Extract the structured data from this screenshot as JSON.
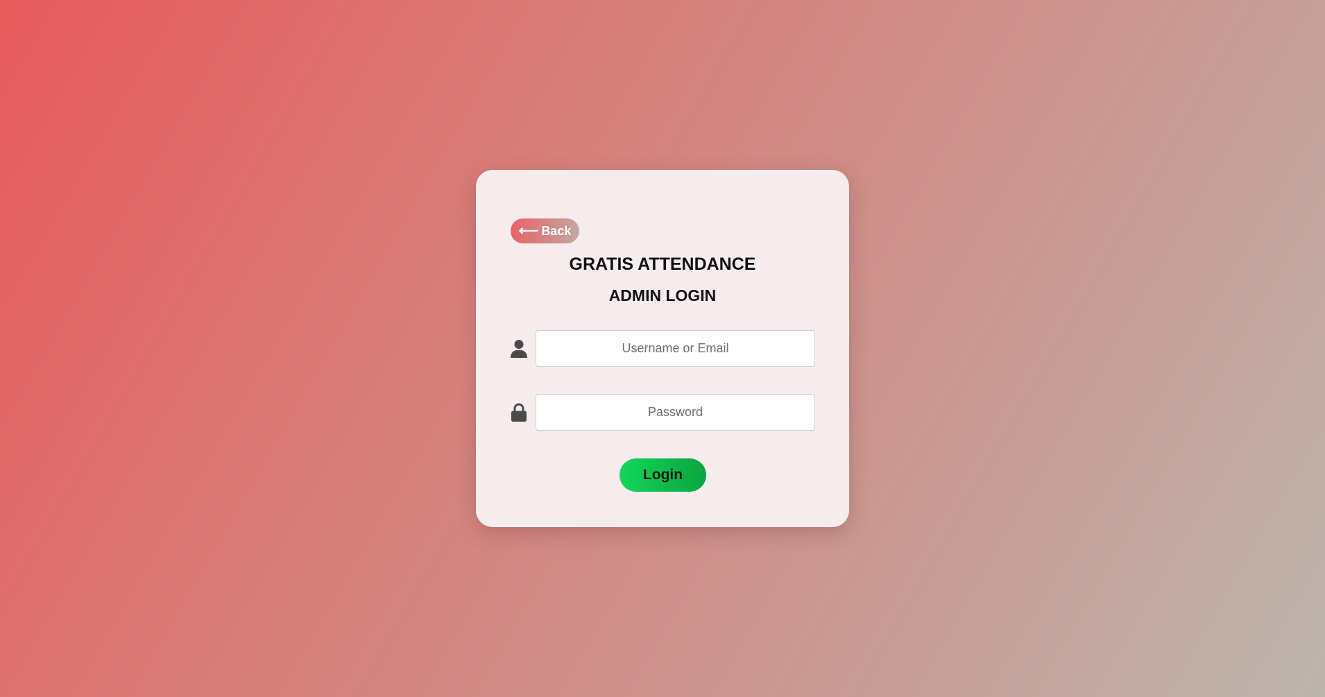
{
  "login_card": {
    "back_button": {
      "arrow_icon": "left-arrow-icon",
      "arrow_glyph": "⟵",
      "label": "Back"
    },
    "title": "GRATIS ATTENDANCE",
    "subtitle": "ADMIN LOGIN",
    "username_field": {
      "icon": "user-icon",
      "placeholder": "Username or Email",
      "value": ""
    },
    "password_field": {
      "icon": "lock-icon",
      "placeholder": "Password",
      "value": ""
    },
    "login_button": {
      "label": "Login"
    }
  },
  "colors": {
    "background_start": "#e85a5c",
    "background_end": "#bcb5ac",
    "card_background": "#f6eced",
    "login_button": "#13d65a",
    "back_button": "#e86366",
    "icon_color": "#4a4a4a"
  }
}
